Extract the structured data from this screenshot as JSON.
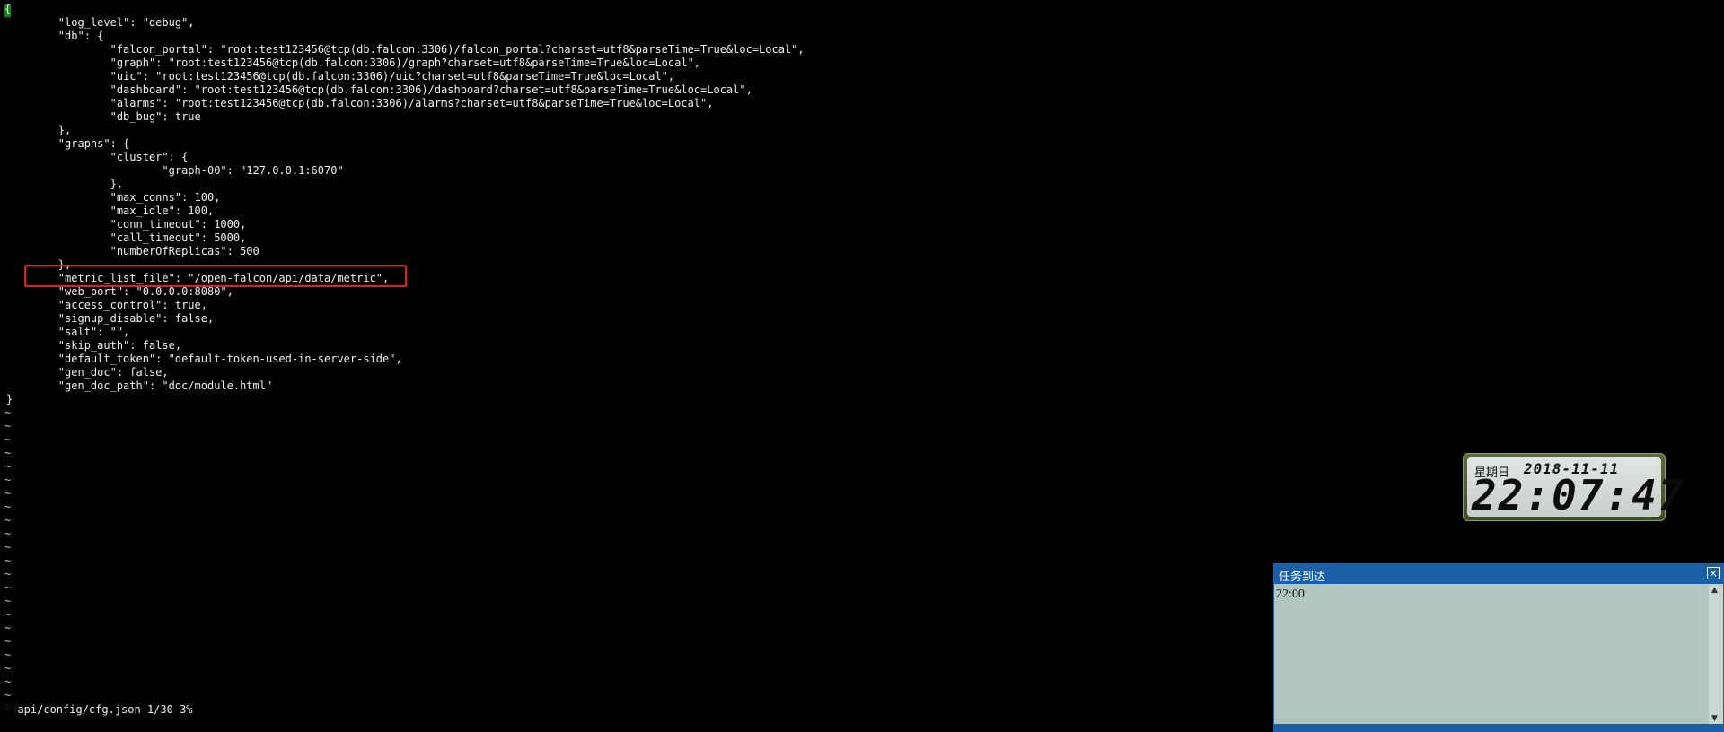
{
  "editor": {
    "cursor_char": "{",
    "lines": [
      "        \"log_level\": \"debug\",",
      "        \"db\": {",
      "                \"falcon_portal\": \"root:test123456@tcp(db.falcon:3306)/falcon_portal?charset=utf8&parseTime=True&loc=Local\",",
      "                \"graph\": \"root:test123456@tcp(db.falcon:3306)/graph?charset=utf8&parseTime=True&loc=Local\",",
      "                \"uic\": \"root:test123456@tcp(db.falcon:3306)/uic?charset=utf8&parseTime=True&loc=Local\",",
      "                \"dashboard\": \"root:test123456@tcp(db.falcon:3306)/dashboard?charset=utf8&parseTime=True&loc=Local\",",
      "                \"alarms\": \"root:test123456@tcp(db.falcon:3306)/alarms?charset=utf8&parseTime=True&loc=Local\",",
      "                \"db_bug\": true",
      "        },",
      "        \"graphs\": {",
      "                \"cluster\": {",
      "                        \"graph-00\": \"127.0.0.1:6070\"",
      "                },",
      "                \"max_conns\": 100,",
      "                \"max_idle\": 100,",
      "                \"conn_timeout\": 1000,",
      "                \"call_timeout\": 5000,",
      "                \"numberOfReplicas\": 500",
      "        },",
      "        \"metric_list_file\": \"/open-falcon/api/data/metric\",",
      "        \"web_port\": \"0.0.0.0:8080\",",
      "        \"access_control\": true,",
      "        \"signup_disable\": false,",
      "        \"salt\": \"\",",
      "        \"skip_auth\": false,",
      "        \"default_token\": \"default-token-used-in-server-side\",",
      "        \"gen_doc\": false,",
      "        \"gen_doc_path\": \"doc/module.html\"",
      "}"
    ],
    "tildes": [
      "~",
      "~",
      "~",
      "~",
      "~",
      "~",
      "~",
      "~",
      "~",
      "~",
      "~",
      "~",
      "~",
      "~",
      "~",
      "~",
      "~",
      "~",
      "~",
      "~",
      "~",
      "~"
    ],
    "status_line": "- api/config/cfg.json 1/30 3%"
  },
  "clock": {
    "weekday": "星期日",
    "date": "2018-11-11",
    "time": "22:07:47"
  },
  "popup": {
    "title": "任务到达",
    "close_glyph": "×",
    "message": "22:00",
    "scroll_up": "▲",
    "scroll_down": "▼"
  },
  "colors": {
    "highlight_box": "#e02020",
    "popup_title_bar": "#1a5fa8",
    "popup_body": "#b2c6c1",
    "cursor": "#0f8a0f"
  }
}
